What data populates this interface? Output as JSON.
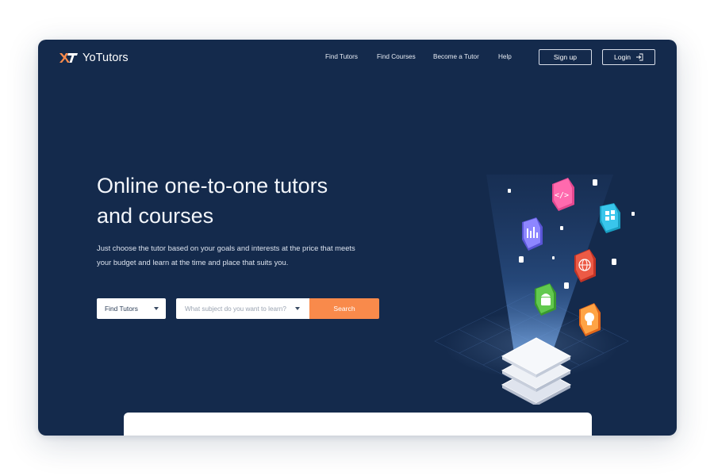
{
  "brand": {
    "name": "YoTutors",
    "accent_color": "#f98a4b",
    "background_color": "#142a4c"
  },
  "nav": {
    "links": [
      {
        "label": "Find Tutors"
      },
      {
        "label": "Find Courses"
      },
      {
        "label": "Become a Tutor"
      },
      {
        "label": "Help"
      }
    ],
    "signup_label": "Sign up",
    "login_label": "Login",
    "login_icon": "login-arrow-icon"
  },
  "hero": {
    "title_line1": "Online one-to-one tutors",
    "title_line2": "and courses",
    "subtitle_line1": "Just choose the tutor based on your goals and interests at the price that meets",
    "subtitle_line2": "your budget and learn at the time and place that suits you."
  },
  "search": {
    "category_value": "Find Tutors",
    "subject_placeholder": "What subject do you want to learn?",
    "button_label": "Search"
  },
  "illustration": {
    "icons": [
      "code-icon",
      "bar-chart-icon",
      "grid-apps-icon",
      "globe-icon",
      "android-icon",
      "lightbulb-icon"
    ]
  }
}
